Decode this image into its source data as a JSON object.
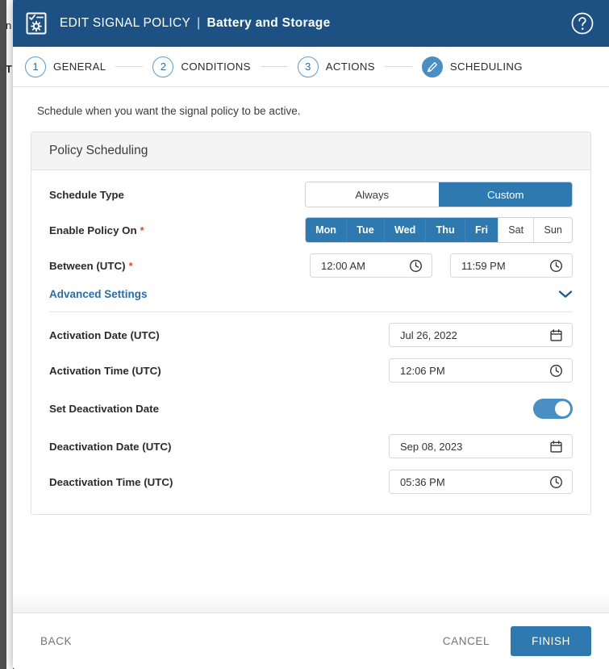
{
  "background": {
    "fragment_top": "n",
    "fragment_mid": "T"
  },
  "titlebar": {
    "icon": "policy-document-gear-icon",
    "main": "EDIT SIGNAL POLICY",
    "separator": "|",
    "sub": "Battery and Storage",
    "help_icon": "help-circle-icon"
  },
  "stepper": {
    "steps": [
      {
        "num": "1",
        "label": "GENERAL",
        "active": false
      },
      {
        "num": "2",
        "label": "CONDITIONS",
        "active": false
      },
      {
        "num": "3",
        "label": "ACTIONS",
        "active": false
      },
      {
        "num": "",
        "label": "SCHEDULING",
        "active": true,
        "icon": "pencil-icon"
      }
    ]
  },
  "main": {
    "intro": "Schedule when you want the signal policy to be active.",
    "panel_title": "Policy Scheduling",
    "schedule_type": {
      "label": "Schedule Type",
      "options": [
        "Always",
        "Custom"
      ],
      "selected": "Custom"
    },
    "enable_policy_on": {
      "label": "Enable Policy On",
      "required": "*",
      "days": [
        {
          "label": "Mon",
          "on": true
        },
        {
          "label": "Tue",
          "on": true
        },
        {
          "label": "Wed",
          "on": true
        },
        {
          "label": "Thu",
          "on": true
        },
        {
          "label": "Fri",
          "on": true
        },
        {
          "label": "Sat",
          "on": false
        },
        {
          "label": "Sun",
          "on": false
        }
      ]
    },
    "between": {
      "label": "Between (UTC)",
      "required": "*",
      "start": "12:00 AM",
      "end": "11:59 PM",
      "icon": "clock-icon"
    },
    "advanced": {
      "link": "Advanced Settings",
      "chevron": "chevron-down-icon"
    },
    "activation_date": {
      "label": "Activation Date (UTC)",
      "value": "Jul 26, 2022",
      "icon": "calendar-icon"
    },
    "activation_time": {
      "label": "Activation Time (UTC)",
      "value": "12:06 PM",
      "icon": "clock-icon"
    },
    "set_deactivation": {
      "label": "Set Deactivation Date",
      "state": "on"
    },
    "deactivation_date": {
      "label": "Deactivation Date (UTC)",
      "value": "Sep 08, 2023",
      "icon": "calendar-icon"
    },
    "deactivation_time": {
      "label": "Deactivation Time (UTC)",
      "value": "05:36 PM",
      "icon": "clock-icon"
    }
  },
  "footer": {
    "back": "BACK",
    "cancel": "CANCEL",
    "finish": "FINISH"
  },
  "colors": {
    "header_blue": "#1d5183",
    "accent_blue": "#2e79b0",
    "toggle_blue": "#4a8fc4",
    "link_blue": "#2a6ca8",
    "required_red": "#d9492b"
  }
}
